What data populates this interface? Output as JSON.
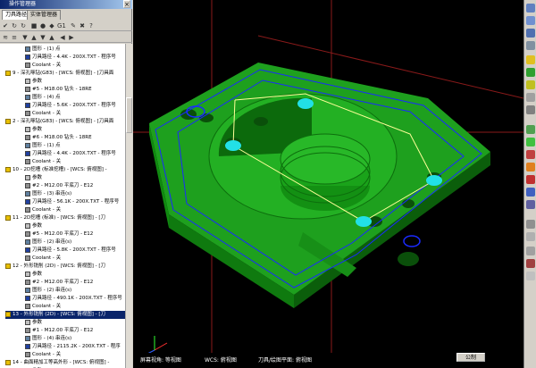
{
  "panel": {
    "title": "操作管理器",
    "tabs": [
      "刀具路径",
      "实体管理器"
    ]
  },
  "tree_rows": [
    {
      "indent": 28,
      "icon": "graph",
      "text": "图形 - (1) 点"
    },
    {
      "indent": 28,
      "icon": "path",
      "text": "刀具路径 - 4.4K - 200X.TXT - 程序号"
    },
    {
      "indent": 28,
      "icon": "tool",
      "text": "Coolant - 关"
    },
    {
      "indent": 6,
      "icon": "folder",
      "text": "9 - 深孔啄钻(G83) - [WCS: 俯视图] - [刀具面"
    },
    {
      "indent": 28,
      "icon": "param",
      "text": "参数"
    },
    {
      "indent": 28,
      "icon": "tool",
      "text": "#5 - M18.00 钻头 - 18RE"
    },
    {
      "indent": 28,
      "icon": "graph",
      "text": "图形 - (4) 点"
    },
    {
      "indent": 28,
      "icon": "path",
      "text": "刀具路径 - 5.6K - 200X.TXT - 程序号"
    },
    {
      "indent": 28,
      "icon": "tool",
      "text": "Coolant - 关"
    },
    {
      "indent": 6,
      "icon": "folder",
      "text": "2 - 深孔啄钻(G83) - [WCS: 俯视图] - [刀具面"
    },
    {
      "indent": 28,
      "icon": "param",
      "text": "参数"
    },
    {
      "indent": 28,
      "icon": "tool",
      "text": "#6 - M18.00 钻头 - 18RE"
    },
    {
      "indent": 28,
      "icon": "graph",
      "text": "图形 - (1) 点"
    },
    {
      "indent": 28,
      "icon": "path",
      "text": "刀具路径 - 4.4K - 200X.TXT - 程序号"
    },
    {
      "indent": 28,
      "icon": "tool",
      "text": "Coolant - 关"
    },
    {
      "indent": 6,
      "icon": "folder",
      "text": "10 - 2D挖槽 (标准挖槽) - [WCS: 俯视图] -"
    },
    {
      "indent": 28,
      "icon": "param",
      "text": "参数"
    },
    {
      "indent": 28,
      "icon": "tool",
      "text": "#2 - M12.00 平底刀 - E12"
    },
    {
      "indent": 28,
      "icon": "graph",
      "text": "图形 - (3) 串连(s)"
    },
    {
      "indent": 28,
      "icon": "path",
      "text": "刀具路径 - 56.1K - 200X.TXT - 程序号"
    },
    {
      "indent": 28,
      "icon": "tool",
      "text": "Coolant - 关"
    },
    {
      "indent": 6,
      "icon": "folder",
      "text": "11 - 2D挖槽 (标准) - [WCS: 俯视图] - [刀"
    },
    {
      "indent": 28,
      "icon": "param",
      "text": "参数"
    },
    {
      "indent": 28,
      "icon": "tool",
      "text": "#5 - M12.00 平底刀 - E12"
    },
    {
      "indent": 28,
      "icon": "graph",
      "text": "图形 - (2) 串连(s)"
    },
    {
      "indent": 28,
      "icon": "path",
      "text": "刀具路径 - 5.8K - 200X.TXT - 程序号"
    },
    {
      "indent": 28,
      "icon": "tool",
      "text": "Coolant - 关"
    },
    {
      "indent": 6,
      "icon": "folder",
      "text": "12 - 外形铣削 (2D) - [WCS: 俯视图] - [刀"
    },
    {
      "indent": 28,
      "icon": "param",
      "text": "参数"
    },
    {
      "indent": 28,
      "icon": "tool",
      "text": "#2 - M12.00 平底刀 - E12"
    },
    {
      "indent": 28,
      "icon": "graph",
      "text": "图形 - (2) 串连(s)"
    },
    {
      "indent": 28,
      "icon": "path",
      "text": "刀具路径 - 490.1K - 200X.TXT - 程序号"
    },
    {
      "indent": 28,
      "icon": "tool",
      "text": "Coolant - 关"
    },
    {
      "indent": 6,
      "icon": "folder",
      "text": "13 - 外形铣削 (2D) - [WCS: 俯视图] - [刀",
      "selected": true
    },
    {
      "indent": 28,
      "icon": "param",
      "text": "参数"
    },
    {
      "indent": 28,
      "icon": "tool",
      "text": "#1 - M12.00 平底刀 - E12"
    },
    {
      "indent": 28,
      "icon": "graph",
      "text": "图形 - (4) 串连(s)"
    },
    {
      "indent": 28,
      "icon": "path",
      "text": "刀具路径 - 2115.2K - 200X.TXT - 程序"
    },
    {
      "indent": 28,
      "icon": "tool",
      "text": "Coolant - 关"
    },
    {
      "indent": 6,
      "icon": "folder",
      "text": "14 - 曲面精加工等高外形 - [WCS: 俯视图] -"
    },
    {
      "indent": 28,
      "icon": "param",
      "text": "参数"
    }
  ],
  "status": {
    "view": "屏幕视角: 等视图",
    "wcs": "WCS: 俯视图",
    "plane": "刀具/绘图平面: 俯视图",
    "units": "公制"
  },
  "colors": {
    "part_green": "#1aa31a",
    "part_dark": "#0d6e0d",
    "toolpath_blue": "#1a2aff",
    "point_cyan": "#22e0e6",
    "line_yellow": "#ffff99"
  }
}
